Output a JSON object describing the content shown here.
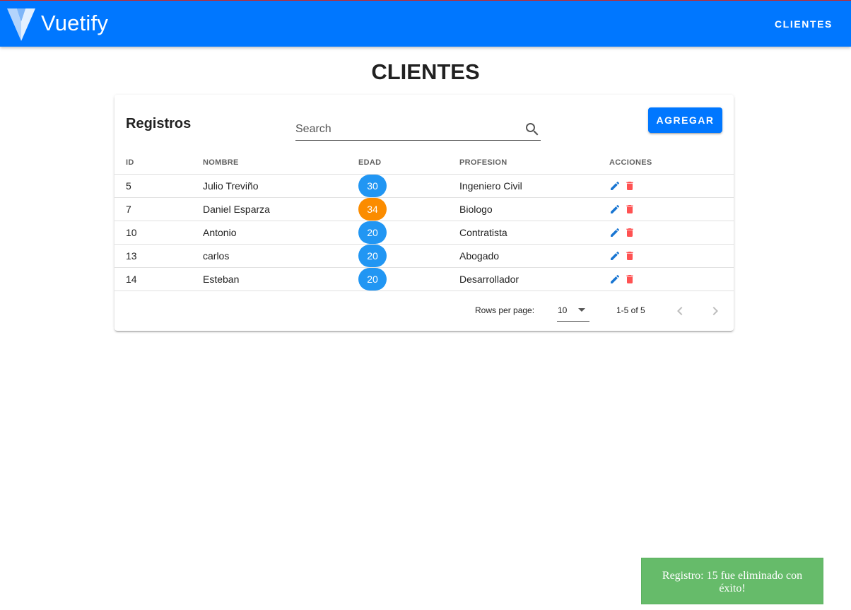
{
  "app": {
    "brand": "Vuetify",
    "nav_clientes": "CLIENTES"
  },
  "page": {
    "title": "CLIENTES"
  },
  "card": {
    "title": "Registros",
    "search_placeholder": "Search",
    "add_button": "AGREGAR"
  },
  "table": {
    "headers": [
      "ID",
      "NOMBRE",
      "EDAD",
      "PROFESION",
      "ACCIONES"
    ],
    "rows": [
      {
        "id": "5",
        "nombre": "Julio Treviño",
        "edad": "30",
        "edad_color": "#2196f3",
        "profesion": "Ingeniero Civil"
      },
      {
        "id": "7",
        "nombre": "Daniel Esparza",
        "edad": "34",
        "edad_color": "#fb8c00",
        "profesion": "Biologo"
      },
      {
        "id": "10",
        "nombre": "Antonio",
        "edad": "20",
        "edad_color": "#2196f3",
        "profesion": "Contratista"
      },
      {
        "id": "13",
        "nombre": "carlos",
        "edad": "20",
        "edad_color": "#2196f3",
        "profesion": "Abogado"
      },
      {
        "id": "14",
        "nombre": "Esteban",
        "edad": "20",
        "edad_color": "#2196f3",
        "profesion": "Desarrollador"
      }
    ],
    "icons": {
      "edit": "pencil-icon",
      "delete": "trash-icon"
    },
    "colors": {
      "edit": "#1976d2",
      "delete": "#ff5252"
    }
  },
  "footer": {
    "rows_per_page_label": "Rows per page:",
    "rows_per_page_value": "10",
    "range": "1-5 of 5"
  },
  "snackbar": {
    "message": "Registro: 15 fue eliminado con éxito!"
  },
  "colors": {
    "primary": "#0077ff",
    "snackbar_bg": "#66bb6a"
  }
}
